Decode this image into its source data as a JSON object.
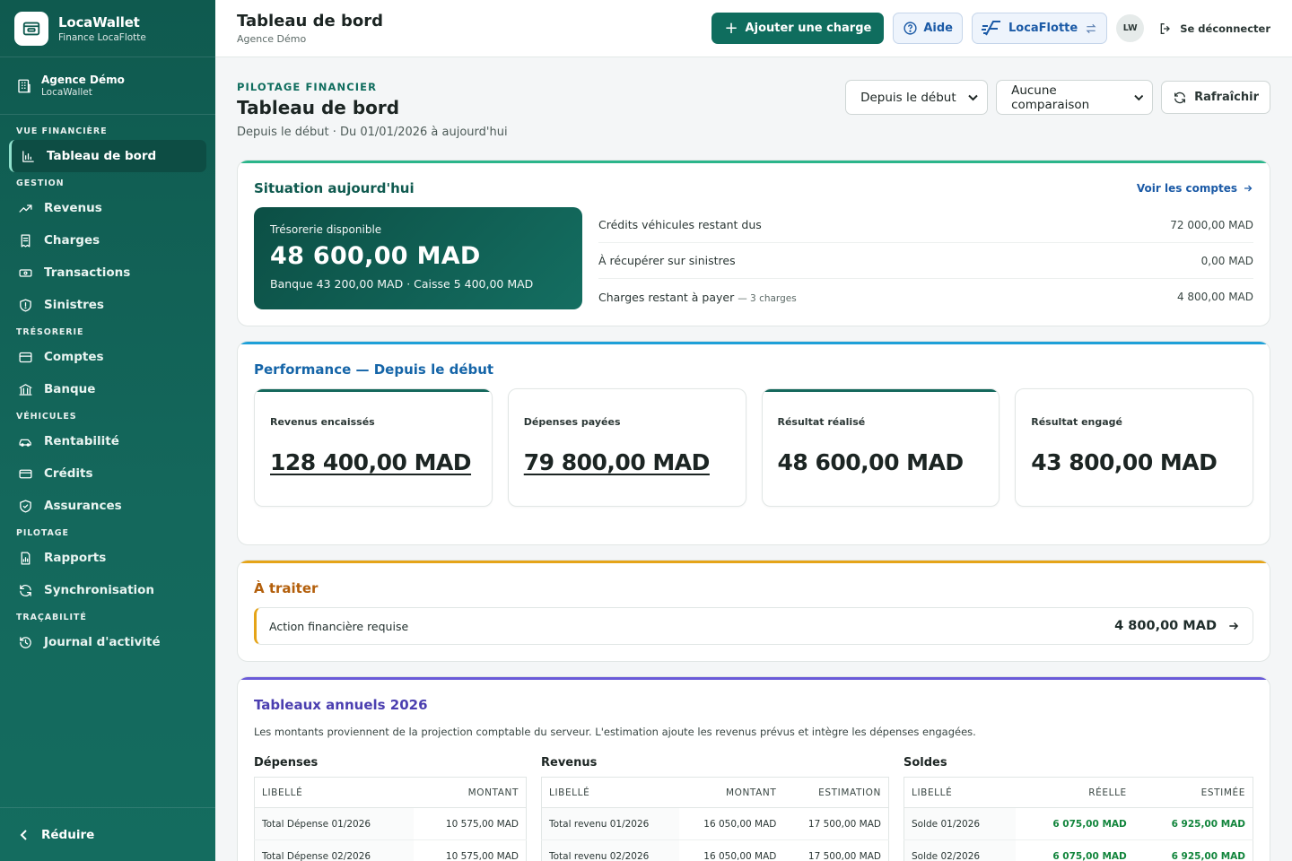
{
  "brand": {
    "title": "LocaWallet",
    "subtitle": "Finance LocaFlotte"
  },
  "agency": {
    "name": "Agence Démo",
    "sub": "LocaWallet"
  },
  "nav": {
    "sections": [
      {
        "label": "VUE FINANCIÈRE",
        "items": [
          {
            "label": "Tableau de bord",
            "icon": "bar-chart-icon",
            "active": true
          }
        ]
      },
      {
        "label": "GESTION",
        "items": [
          {
            "label": "Revenus",
            "icon": "trend-up-icon"
          },
          {
            "label": "Charges",
            "icon": "receipt-icon"
          },
          {
            "label": "Transactions",
            "icon": "cash-icon"
          },
          {
            "label": "Sinistres",
            "icon": "shield-icon"
          }
        ]
      },
      {
        "label": "TRÉSORERIE",
        "items": [
          {
            "label": "Comptes",
            "icon": "wallet-icon"
          },
          {
            "label": "Banque",
            "icon": "bank-icon"
          }
        ]
      },
      {
        "label": "VÉHICULES",
        "items": [
          {
            "label": "Rentabilité",
            "icon": "car-icon"
          },
          {
            "label": "Crédits",
            "icon": "credit-card-icon"
          },
          {
            "label": "Assurances",
            "icon": "shield-check-icon"
          }
        ]
      },
      {
        "label": "PILOTAGE",
        "items": [
          {
            "label": "Rapports",
            "icon": "report-icon"
          },
          {
            "label": "Synchronisation",
            "icon": "sync-icon"
          }
        ]
      },
      {
        "label": "TRAÇABILITÉ",
        "items": [
          {
            "label": "Journal d'activité",
            "icon": "history-icon"
          }
        ]
      }
    ],
    "collapse_label": "Réduire"
  },
  "topbar": {
    "title": "Tableau de bord",
    "subtitle": "Agence Démo",
    "add_charge": "Ajouter une charge",
    "help": "Aide",
    "locaflotte": "LocaFlotte",
    "avatar": "LW",
    "logout": "Se déconnecter"
  },
  "page": {
    "eyebrow": "PILOTAGE FINANCIER",
    "title": "Tableau de bord",
    "subtitle": "Depuis le début · Du 01/01/2026 à aujourd'hui",
    "period_select": "Depuis le début",
    "comparison_select": "Aucune comparaison",
    "refresh": "Rafraîchir"
  },
  "situation": {
    "title": "Situation aujourd'hui",
    "see_accounts": "Voir les comptes",
    "treasury_label": "Trésorerie disponible",
    "treasury_amount": "48 600,00 MAD",
    "treasury_split": "Banque 43 200,00 MAD · Caisse 5 400,00 MAD",
    "rows": [
      {
        "label": "Crédits véhicules restant dus",
        "sub": "",
        "value": "72 000,00 MAD"
      },
      {
        "label": "À récupérer sur sinistres",
        "sub": "",
        "value": "0,00 MAD"
      },
      {
        "label": "Charges restant à payer",
        "sub": "— 3 charges",
        "value": "4 800,00 MAD"
      }
    ],
    "accent": "#2bb58a"
  },
  "performance": {
    "title": "Performance — Depuis le début",
    "accent": "#1ea0d8",
    "kpis": [
      {
        "label": "Revenus encaissés",
        "value": "128 400,00 MAD",
        "link": true,
        "accent": true
      },
      {
        "label": "Dépenses payées",
        "value": "79 800,00 MAD",
        "link": true,
        "accent": false
      },
      {
        "label": "Résultat réalisé",
        "value": "48 600,00 MAD",
        "link": false,
        "accent": true
      },
      {
        "label": "Résultat engagé",
        "value": "43 800,00 MAD",
        "link": false,
        "accent": false
      }
    ]
  },
  "todo": {
    "title": "À traiter",
    "accent": "#e5a418",
    "item_label": "Action financière requise",
    "item_amount": "4 800,00 MAD"
  },
  "annual": {
    "title": "Tableaux annuels 2026",
    "accent": "#6a5ad8",
    "description": "Les montants proviennent de la projection comptable du serveur. L'estimation ajoute les revenus prévus et intègre les dépenses engagées.",
    "expenses": {
      "title": "Dépenses",
      "headers": [
        "LIBELLÉ",
        "MONTANT"
      ],
      "rows": [
        [
          "Total Dépense 01/2026",
          "10 575,00 MAD"
        ],
        [
          "Total Dépense 02/2026",
          "10 575,00 MAD"
        ]
      ]
    },
    "revenues": {
      "title": "Revenus",
      "headers": [
        "LIBELLÉ",
        "MONTANT",
        "ESTIMATION"
      ],
      "rows": [
        [
          "Total revenu 01/2026",
          "16 050,00 MAD",
          "17 500,00 MAD"
        ],
        [
          "Total revenu 02/2026",
          "16 050,00 MAD",
          "17 500,00 MAD"
        ]
      ]
    },
    "balances": {
      "title": "Soldes",
      "headers": [
        "LIBELLÉ",
        "RÉELLE",
        "ESTIMÉE"
      ],
      "rows": [
        [
          "Solde 01/2026",
          "6 075,00 MAD",
          "6 925,00 MAD"
        ],
        [
          "Solde 02/2026",
          "6 075,00 MAD",
          "6 925,00 MAD"
        ]
      ]
    }
  }
}
